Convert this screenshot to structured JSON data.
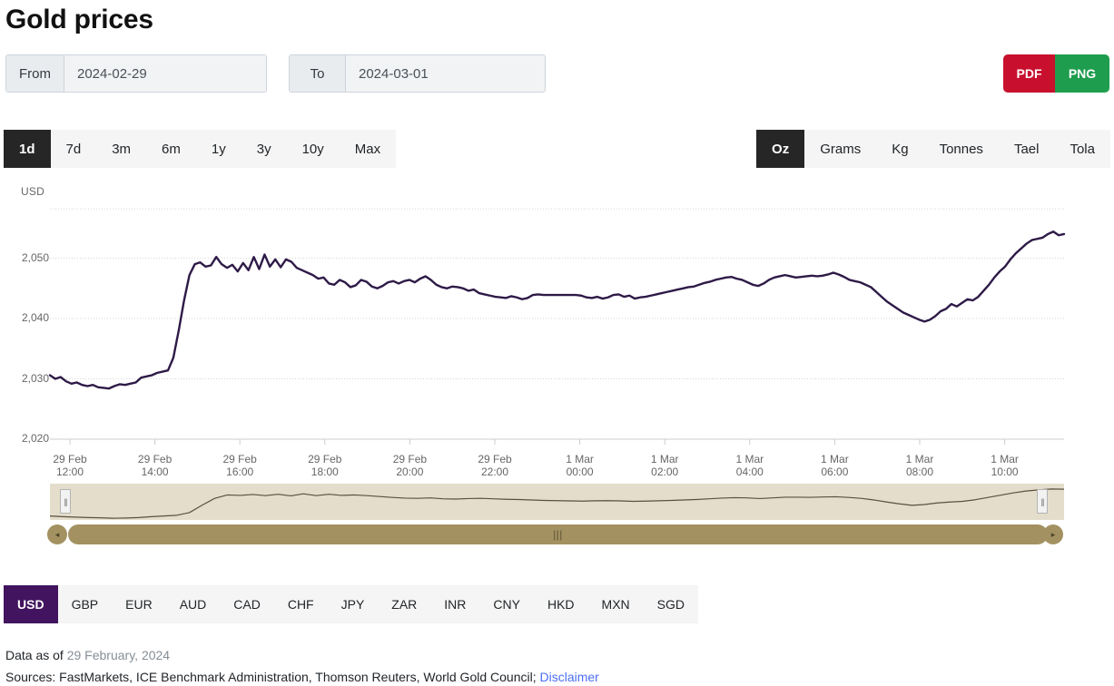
{
  "page_title": "Gold prices",
  "daterange": {
    "from_label": "From",
    "from_value": "2024-02-29",
    "to_label": "To",
    "to_value": "2024-03-01"
  },
  "export": {
    "pdf_label": "PDF",
    "png_label": "PNG",
    "pdf_color": "#c8102e",
    "png_color": "#1f9d4e"
  },
  "range_tabs": {
    "active": "1d",
    "items": [
      "1d",
      "7d",
      "3m",
      "6m",
      "1y",
      "3y",
      "10y",
      "Max"
    ]
  },
  "unit_tabs": {
    "active": "Oz",
    "items": [
      "Oz",
      "Grams",
      "Kg",
      "Tonnes",
      "Tael",
      "Tola"
    ]
  },
  "currency_tabs": {
    "active": "USD",
    "active_color": "#42145f",
    "items": [
      "USD",
      "GBP",
      "EUR",
      "AUD",
      "CAD",
      "CHF",
      "JPY",
      "ZAR",
      "INR",
      "CNY",
      "HKD",
      "MXN",
      "SGD"
    ]
  },
  "footer": {
    "data_as_of_label": "Data as of",
    "data_as_of_value": "29 February, 2024",
    "sources_text": "Sources: FastMarkets, ICE Benchmark Administration, Thomson Reuters, World Gold Council;",
    "disclaimer_label": "Disclaimer"
  },
  "navigator": {
    "left_arrow": "◂",
    "right_arrow": "▸",
    "grip": "|||",
    "handle_grip": "||",
    "band_color": "#e4ddcb",
    "scrollbar_color": "#a39161"
  },
  "chart_data": {
    "type": "line",
    "title": "Gold prices",
    "xlabel": "",
    "ylabel": "USD",
    "unit_label": "USD",
    "series_color": "#2e1a47",
    "grid": true,
    "legend": "none",
    "ylim": [
      2020,
      2058.5
    ],
    "yticks": [
      2020,
      2030,
      2040,
      2050
    ],
    "ytick_labels": [
      "2,020",
      "2,030",
      "2,040",
      "2,050"
    ],
    "x_tick_labels": [
      [
        "29 Feb",
        "12:00"
      ],
      [
        "29 Feb",
        "14:00"
      ],
      [
        "29 Feb",
        "16:00"
      ],
      [
        "29 Feb",
        "18:00"
      ],
      [
        "29 Feb",
        "20:00"
      ],
      [
        "29 Feb",
        "22:00"
      ],
      [
        "1 Mar",
        "00:00"
      ],
      [
        "1 Mar",
        "02:00"
      ],
      [
        "1 Mar",
        "04:00"
      ],
      [
        "1 Mar",
        "06:00"
      ],
      [
        "1 Mar",
        "08:00"
      ],
      [
        "1 Mar",
        "10:00"
      ]
    ],
    "xlim_labels": [
      "29 Feb 11:40",
      "1 Mar 11:20"
    ],
    "values": [
      2030.6,
      2030.0,
      2030.3,
      2029.6,
      2029.2,
      2029.4,
      2029.0,
      2028.8,
      2029.0,
      2028.6,
      2028.5,
      2028.4,
      2028.8,
      2029.1,
      2029.0,
      2029.2,
      2029.4,
      2030.2,
      2030.4,
      2030.6,
      2031.0,
      2031.2,
      2031.4,
      2033.5,
      2038.0,
      2043.0,
      2047.2,
      2049.0,
      2049.3,
      2048.6,
      2048.8,
      2050.2,
      2049.0,
      2048.4,
      2048.9,
      2047.8,
      2049.2,
      2048.0,
      2050.2,
      2048.2,
      2050.6,
      2048.6,
      2049.8,
      2048.5,
      2049.8,
      2049.4,
      2048.4,
      2048.0,
      2047.6,
      2047.2,
      2046.6,
      2046.8,
      2045.8,
      2045.6,
      2046.4,
      2046.0,
      2045.2,
      2045.5,
      2046.4,
      2046.1,
      2045.3,
      2045.0,
      2045.4,
      2046.0,
      2046.2,
      2045.8,
      2046.2,
      2046.4,
      2046.0,
      2046.6,
      2047.0,
      2046.4,
      2045.6,
      2045.2,
      2045.0,
      2045.3,
      2045.2,
      2045.0,
      2044.6,
      2044.8,
      2044.2,
      2044.0,
      2043.8,
      2043.6,
      2043.5,
      2043.4,
      2043.7,
      2043.5,
      2043.2,
      2043.4,
      2043.9,
      2044.0,
      2043.9,
      2043.9,
      2043.9,
      2043.9,
      2043.9,
      2043.9,
      2043.9,
      2043.8,
      2043.5,
      2043.4,
      2043.6,
      2043.3,
      2043.5,
      2043.9,
      2044.0,
      2043.6,
      2043.8,
      2043.3,
      2043.5,
      2043.6,
      2043.8,
      2044.0,
      2044.2,
      2044.4,
      2044.6,
      2044.8,
      2045.0,
      2045.2,
      2045.3,
      2045.6,
      2045.9,
      2046.1,
      2046.4,
      2046.6,
      2046.8,
      2046.9,
      2046.6,
      2046.4,
      2046.0,
      2045.6,
      2045.4,
      2045.8,
      2046.4,
      2046.8,
      2047.0,
      2047.2,
      2047.0,
      2046.8,
      2046.9,
      2047.0,
      2047.1,
      2047.0,
      2047.1,
      2047.3,
      2047.6,
      2047.3,
      2046.9,
      2046.4,
      2046.2,
      2046.0,
      2045.6,
      2045.2,
      2044.4,
      2043.6,
      2042.8,
      2042.2,
      2041.6,
      2041.0,
      2040.6,
      2040.2,
      2039.8,
      2039.5,
      2039.8,
      2040.4,
      2041.2,
      2041.6,
      2042.4,
      2042.0,
      2042.6,
      2043.2,
      2043.0,
      2043.6,
      2044.6,
      2045.6,
      2046.8,
      2047.8,
      2048.6,
      2049.8,
      2050.8,
      2051.6,
      2052.4,
      2053.0,
      2053.2,
      2053.4,
      2054.0,
      2054.4,
      2053.8,
      2054.0
    ],
    "navigator_values": [
      2030.6,
      2030.0,
      2029.6,
      2029.2,
      2029.0,
      2028.6,
      2028.8,
      2029.2,
      2030.0,
      2030.6,
      2031.2,
      2033.5,
      2040.0,
      2046.0,
      2049.0,
      2048.6,
      2049.4,
      2048.4,
      2049.6,
      2048.2,
      2050.0,
      2048.4,
      2049.6,
      2048.6,
      2049.0,
      2048.4,
      2047.6,
      2046.8,
      2046.2,
      2046.0,
      2046.4,
      2045.6,
      2045.4,
      2045.8,
      2046.0,
      2045.6,
      2045.2,
      2045.0,
      2044.6,
      2044.2,
      2044.0,
      2043.8,
      2043.6,
      2043.9,
      2044.0,
      2043.8,
      2043.4,
      2043.6,
      2043.9,
      2044.2,
      2044.6,
      2045.0,
      2045.6,
      2046.2,
      2046.6,
      2046.4,
      2045.8,
      2046.4,
      2047.0,
      2047.0,
      2046.9,
      2047.2,
      2047.4,
      2046.8,
      2046.0,
      2044.6,
      2042.8,
      2041.2,
      2039.9,
      2040.6,
      2042.0,
      2042.8,
      2043.4,
      2044.8,
      2046.8,
      2048.8,
      2050.8,
      2052.4,
      2053.4,
      2054.2,
      2054.0
    ]
  }
}
